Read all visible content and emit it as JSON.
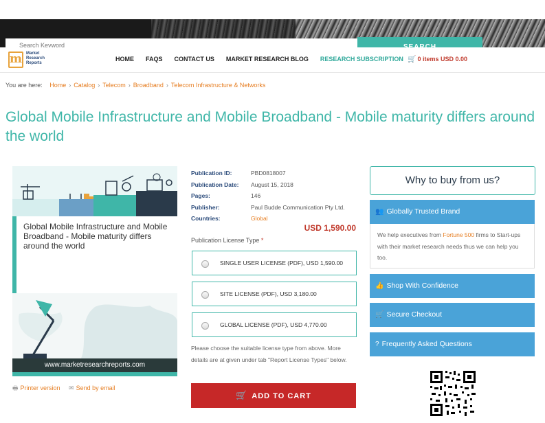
{
  "search": {
    "placeholder": "Search Keyword",
    "button_label": "SEARCH"
  },
  "logo": {
    "letter": "m",
    "line1": "Market",
    "line2": "Research",
    "line3": "Reports"
  },
  "nav": {
    "items": [
      {
        "label": "HOME"
      },
      {
        "label": "FAQS"
      },
      {
        "label": "CONTACT US"
      },
      {
        "label": "MARKET RESEARCH BLOG"
      },
      {
        "label": "RESEARCH SUBSCRIPTION"
      }
    ],
    "cart_label": "0 items USD 0.00"
  },
  "breadcrumb": {
    "prefix": "You are here:",
    "items": [
      "Home",
      "Catalog",
      "Telecom",
      "Broadband",
      "Telecom Infrastructure & Networks"
    ]
  },
  "page_title": "Global Mobile Infrastructure and Mobile Broadband - Mobile maturity differs around the world",
  "report_image": {
    "card_text": "Global Mobile Infrastructure and Mobile Broadband - Mobile maturity differs around the world",
    "url_text": "www.marketresearchreports.com"
  },
  "print_links": {
    "printer": "Printer version",
    "email": "Send by email"
  },
  "details": {
    "publication_id_label": "Publication ID:",
    "publication_id": "PBD0818007",
    "publication_date_label": "Publication Date:",
    "publication_date": "August 15, 2018",
    "pages_label": "Pages:",
    "pages": "146",
    "publisher_label": "Publisher:",
    "publisher": "Paul Budde Communication Pty Ltd.",
    "countries_label": "Countries:",
    "countries": "Global"
  },
  "price": "USD 1,590.00",
  "license": {
    "label": "Publication License Type",
    "required_mark": "*",
    "options": [
      {
        "label": "SINGLE USER LICENSE (PDF), USD 1,590.00"
      },
      {
        "label": "SITE LICENSE (PDF), USD 3,180.00"
      },
      {
        "label": "GLOBAL LICENSE (PDF), USD 4,770.00"
      }
    ],
    "note": "Please choose the suitable license type from above. More details are at given under tab \"Report License Types\" below."
  },
  "add_to_cart_label": "ADD TO CART",
  "sidebar": {
    "why_title": "Why to buy from us?",
    "trusted_title": "Globally Trusted Brand",
    "trusted_text_before": "We help executives from ",
    "trusted_link": "Fortune 500",
    "trusted_text_after": " firms to Start-ups with their market research needs thus we can help you too.",
    "shop_title": "Shop With Confidence",
    "checkout_title": "Secure Checkout",
    "faq_title": "Frequently Asked Questions"
  },
  "colors": {
    "teal": "#3fb6a8",
    "orange": "#e67e22",
    "red": "#c62828",
    "blue": "#4aa3d8"
  }
}
